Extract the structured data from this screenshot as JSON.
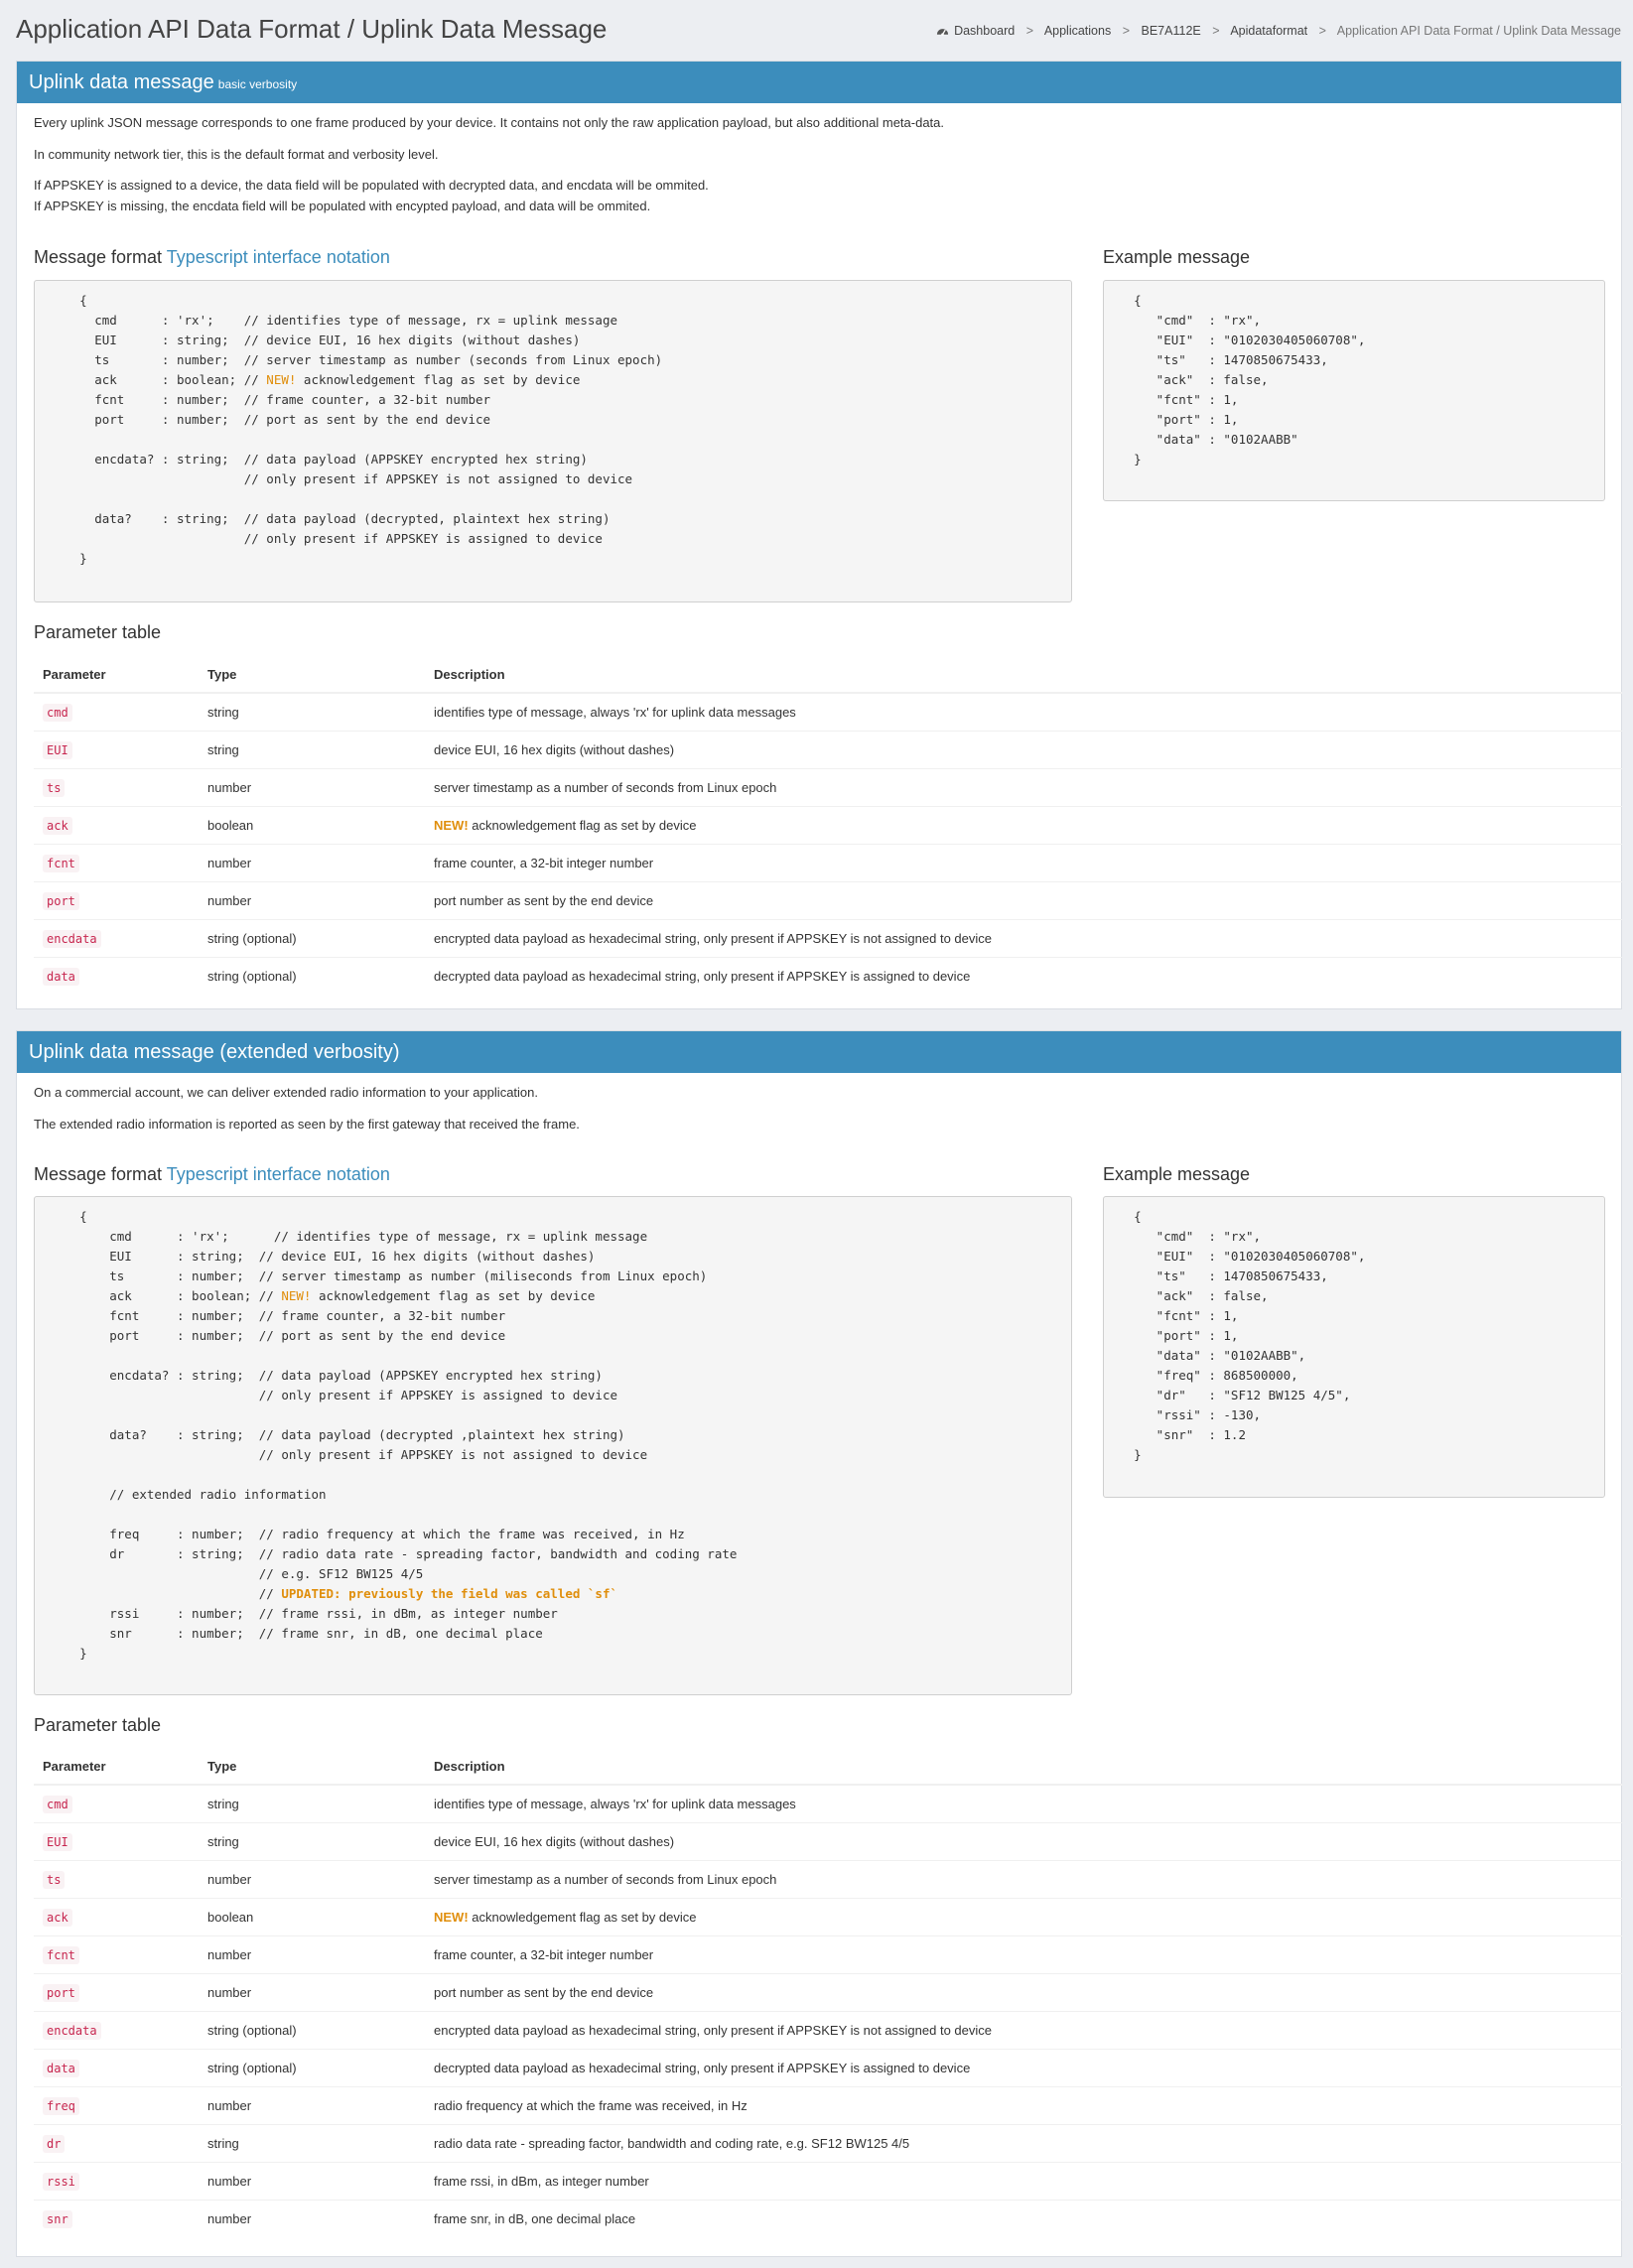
{
  "page": {
    "title": "Application API Data Format / Uplink Data Message",
    "breadcrumb": {
      "dashboard": "Dashboard",
      "applications": "Applications",
      "app_id": "BE7A112E",
      "apidataformat": "Apidataformat",
      "current": "Application API Data Format / Uplink Data Message",
      "separator": ">"
    }
  },
  "panel1": {
    "title": "Uplink data message",
    "subtitle": "basic verbosity",
    "intro": [
      "Every uplink JSON message corresponds to one frame produced by your device. It contains not only the raw application payload, but also additional meta-data.",
      "In community network tier, this is the default format and verbosity level.",
      "If APPSKEY is assigned to a device, the data field will be populated with decrypted data, and encdata will be ommited.",
      "If APPSKEY is missing, the encdata field will be populated with encypted payload, and data will be ommited."
    ],
    "format_heading": "Message format",
    "format_link": "Typescript interface notation",
    "example_heading": "Example message",
    "table_heading": "Parameter table",
    "code": [
      "      {",
      "        cmd      : 'rx';    // identifies type of message, rx = uplink message",
      "        EUI      : string;  // device EUI, 16 hex digits (without dashes)",
      "        ts       : number;  // server timestamp as number (seconds from Linux epoch)",
      "        ack      : boolean; // |NEW!| acknowledgement flag as set by device",
      "        fcnt     : number;  // frame counter, a 32-bit number",
      "        port     : number;  // port as sent by the end device",
      "",
      "        encdata? : string;  // data payload (APPSKEY encrypted hex string)",
      "                            // only present if APPSKEY is not assigned to device",
      "",
      "        data?    : string;  // data payload (decrypted, plaintext hex string)",
      "                            // only present if APPSKEY is assigned to device",
      "      }"
    ],
    "example": [
      "    {",
      "       \"cmd\"  : \"rx\",",
      "       \"EUI\"  : \"0102030405060708\",",
      "       \"ts\"   : 1470850675433,",
      "       \"ack\"  : false,",
      "       \"fcnt\" : 1,",
      "       \"port\" : 1,",
      "       \"data\" : \"0102AABB\"",
      "    }"
    ]
  },
  "panel2": {
    "title": "Uplink data message (extended verbosity)",
    "intro": [
      "On a commercial account, we can deliver extended radio information to your application.",
      "The extended radio information is reported as seen by the first gateway that received the frame."
    ],
    "format_heading": "Message format",
    "format_link": "Typescript interface notation",
    "example_heading": "Example message",
    "table_heading": "Parameter table",
    "code": [
      "      {",
      "          cmd      : 'rx';      // identifies type of message, rx = uplink message",
      "          EUI      : string;  // device EUI, 16 hex digits (without dashes)",
      "          ts       : number;  // server timestamp as number (miliseconds from Linux epoch)",
      "          ack      : boolean; // |NEW!| acknowledgement flag as set by device",
      "          fcnt     : number;  // frame counter, a 32-bit number",
      "          port     : number;  // port as sent by the end device",
      "",
      "          encdata? : string;  // data payload (APPSKEY encrypted hex string)",
      "                              // only present if APPSKEY is assigned to device",
      "",
      "          data?    : string;  // data payload (decrypted ,plaintext hex string)",
      "                              // only present if APPSKEY is not assigned to device",
      "",
      "          // extended radio information",
      "",
      "          freq     : number;  // radio frequency at which the frame was received, in Hz",
      "          dr       : string;  // radio data rate - spreading factor, bandwidth and coding rate",
      "                              // e.g. SF12 BW125 4/5",
      "                              // ^UPDATED: previously the field was called `sf`^",
      "          rssi     : number;  // frame rssi, in dBm, as integer number",
      "          snr      : number;  // frame snr, in dB, one decimal place",
      "      }"
    ],
    "example": [
      "    {",
      "       \"cmd\"  : \"rx\",",
      "       \"EUI\"  : \"0102030405060708\",",
      "       \"ts\"   : 1470850675433,",
      "       \"ack\"  : false,",
      "       \"fcnt\" : 1,",
      "       \"port\" : 1,",
      "       \"data\" : \"0102AABB\",",
      "       \"freq\" : 868500000,",
      "       \"dr\"   : \"SF12 BW125 4/5\",",
      "       \"rssi\" : -130,",
      "       \"snr\"  : 1.2",
      "    }"
    ]
  },
  "table_headers": {
    "parameter": "Parameter",
    "type": "Type",
    "description": "Description"
  },
  "new_label": "NEW!",
  "params_basic": [
    {
      "name": "cmd",
      "type": "string",
      "desc": "identifies type of message, always 'rx' for uplink data messages"
    },
    {
      "name": "EUI",
      "type": "string",
      "desc": "device EUI, 16 hex digits (without dashes)"
    },
    {
      "name": "ts",
      "type": "number",
      "desc": "server timestamp as a number of seconds from Linux epoch"
    },
    {
      "name": "ack",
      "type": "boolean",
      "desc": "acknowledgement flag as set by device",
      "new": true
    },
    {
      "name": "fcnt",
      "type": "number",
      "desc": "frame counter, a 32-bit integer number"
    },
    {
      "name": "port",
      "type": "number",
      "desc": "port number as sent by the end device"
    },
    {
      "name": "encdata",
      "type": "string (optional)",
      "desc": "encrypted data payload as hexadecimal string, only present if APPSKEY is not assigned to device"
    },
    {
      "name": "data",
      "type": "string (optional)",
      "desc": "decrypted data payload as hexadecimal string, only present if APPSKEY is assigned to device"
    }
  ],
  "params_extended": [
    {
      "name": "cmd",
      "type": "string",
      "desc": "identifies type of message, always 'rx' for uplink data messages"
    },
    {
      "name": "EUI",
      "type": "string",
      "desc": "device EUI, 16 hex digits (without dashes)"
    },
    {
      "name": "ts",
      "type": "number",
      "desc": "server timestamp as a number of seconds from Linux epoch"
    },
    {
      "name": "ack",
      "type": "boolean",
      "desc": "acknowledgement flag as set by device",
      "new": true
    },
    {
      "name": "fcnt",
      "type": "number",
      "desc": "frame counter, a 32-bit integer number"
    },
    {
      "name": "port",
      "type": "number",
      "desc": "port number as sent by the end device"
    },
    {
      "name": "encdata",
      "type": "string (optional)",
      "desc": "encrypted data payload as hexadecimal string, only present if APPSKEY is not assigned to device"
    },
    {
      "name": "data",
      "type": "string (optional)",
      "desc": "decrypted data payload as hexadecimal string, only present if APPSKEY is assigned to device"
    },
    {
      "name": "freq",
      "type": "number",
      "desc": "radio frequency at which the frame was received, in Hz"
    },
    {
      "name": "dr",
      "type": "string",
      "desc": "radio data rate - spreading factor, bandwidth and coding rate, e.g. SF12 BW125 4/5"
    },
    {
      "name": "rssi",
      "type": "number",
      "desc": "frame rssi, in dBm, as integer number"
    },
    {
      "name": "snr",
      "type": "number",
      "desc": "frame snr, in dB, one decimal place"
    }
  ],
  "colors": {
    "header_bar": "#3c8dbc",
    "link": "#3c8dbc",
    "param_code": "#c7254e",
    "new_highlight": "#e08e0b",
    "background": "#eceef2"
  },
  "icons": {
    "dashboard": "dashboard-gauge-icon"
  }
}
